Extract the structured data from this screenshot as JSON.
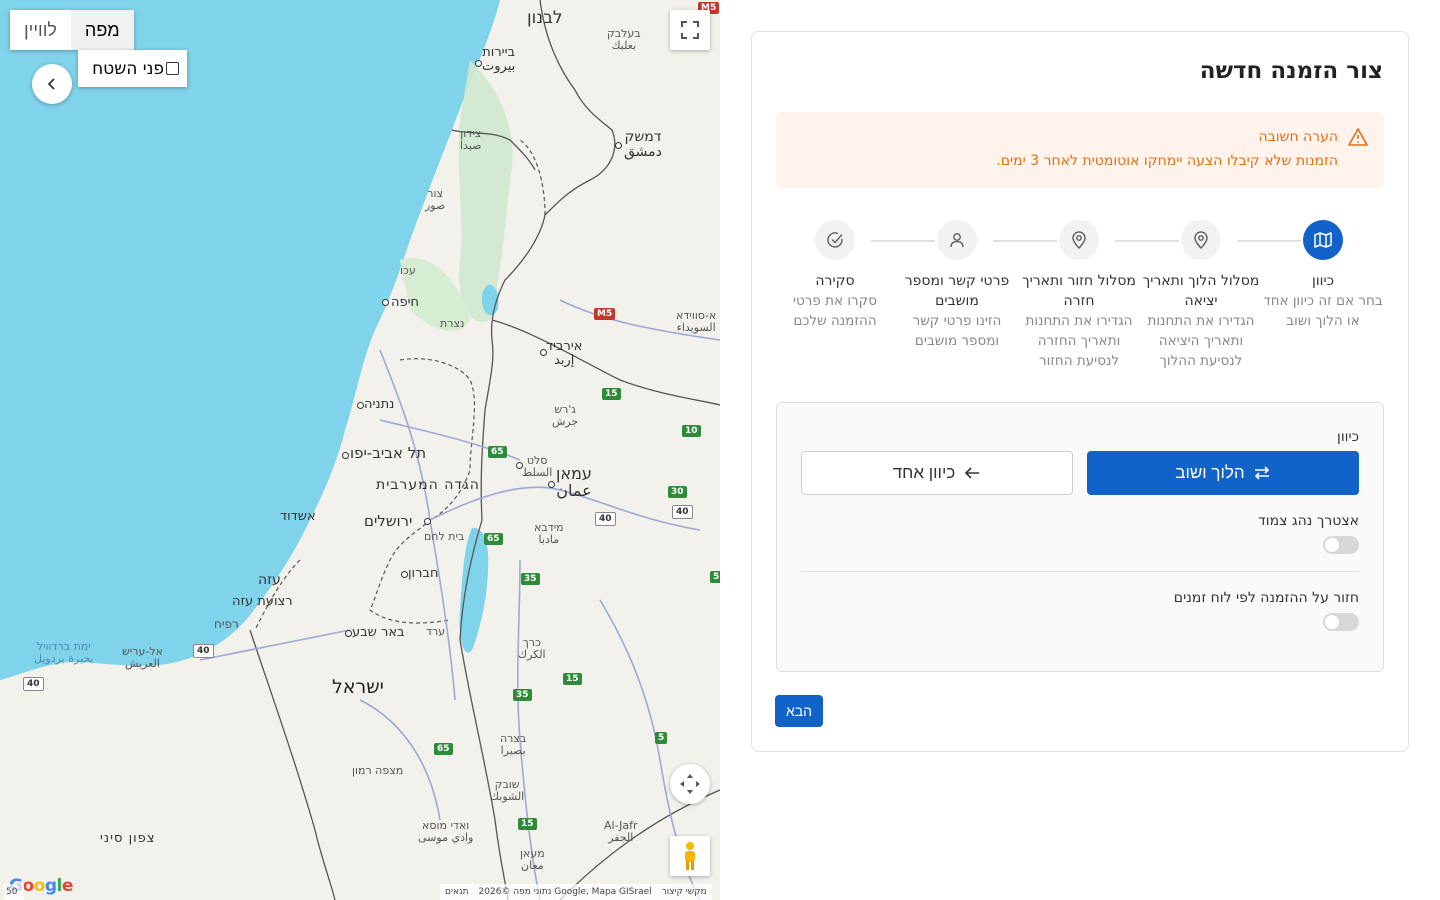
{
  "map": {
    "type_buttons": {
      "map": "מפה",
      "satellite": "לוויין"
    },
    "terrain_label": "פני השטח",
    "attribution": {
      "shortcuts": "מקשי קיצור",
      "data": "נתוני מפה ©2026 Google, Mapa GISrael",
      "terms": "תנאים"
    },
    "google_logo": "Google",
    "scale": "50",
    "labels": {
      "lebanon": "לבנון",
      "baalbek": "בעלבק\nبعلبك",
      "beirut": "ביירות\nبيروت",
      "sidon": "צידון\nصيدا",
      "damascus": "דמשק\nدمشق",
      "tyre": "צור\nصور",
      "acre": "עכו",
      "haifa": "חיפה",
      "nazareth": "נצרת",
      "suwayda": "א-סווידא\nالسويداء",
      "irbid": "אירביד\nإربد",
      "jerash": "ג'רש\nجرش",
      "netanya": "נתניה",
      "telaviv": "תל אביב-יפו",
      "westbank": "הגדה המערבית",
      "salt": "סלט\nالسلط",
      "amman": "עמאן\nعمان",
      "ashdod": "אשדוד",
      "jerusalem": "ירושלים",
      "bethlehem": "בית לחם",
      "madaba": "מידבא\nمادبا",
      "gaza": "עזה",
      "gazastrip": "רצועת עזה",
      "hebron": "חברון",
      "rafah": "רפיח",
      "beersheba": "באר שבע",
      "arad": "ערד",
      "karak": "כרך\nالكرك",
      "bardawil": "ימת ברדוויל\nبحيرة بردويل",
      "arish": "אל-עריש\nالعريش",
      "israel": "ישראל",
      "tafilah": "בצרה\nبصيرا",
      "mitzperamon": "מצפה רמון",
      "shobak": "שובק\nالشوبك",
      "wadimusa": "ואדי מוסא\nوادي موسى",
      "jafr": "Al-Jafr\nالجفر",
      "maan": "מעאן\nمعان",
      "northsinai": "צפון סיני"
    },
    "roads": {
      "m5": "M5",
      "r15": "15",
      "r10": "10",
      "r65": "65",
      "r30": "30",
      "r40": "40",
      "r35": "35",
      "r5": "5"
    }
  },
  "form": {
    "title": "צור הזמנה חדשה",
    "notice": {
      "title": "הערה חשובה",
      "body": "הזמנות שלא קיבלו הצעה יימחקו אוטומטית לאחר 3 ימים."
    },
    "steps": [
      {
        "title": "כיוון",
        "desc": "בחר אם זה כיוון אחד או הלוך ושוב"
      },
      {
        "title": "מסלול הלוך ותאריך יציאה",
        "desc": "הגדירו את התחנות ותאריך היציאה לנסיעת ההלוך"
      },
      {
        "title": "מסלול חזור ותאריך חזרה",
        "desc": "הגדירו את התחנות ותאריך החזרה לנסיעת החזור"
      },
      {
        "title": "פרטי קשר ומספר מושבים",
        "desc": "הזינו פרטי קשר ומספר מושבים"
      },
      {
        "title": "סקירה",
        "desc": "סקרו את פרטי ההזמנה שלכם"
      }
    ],
    "direction_label": "כיוון",
    "round_trip": "הלוך ושוב",
    "one_way": "כיוון אחד",
    "driver_label": "אצטרך נהג צמוד",
    "driver_on": false,
    "repeat_label": "חזור על ההזמנה לפי לוח זמנים",
    "repeat_on": false,
    "next": "הבא"
  },
  "colors": {
    "primary": "#1163c9",
    "notice_bg": "#fff3eb",
    "notice_text": "#e07016",
    "sea": "#7fd3ea"
  }
}
